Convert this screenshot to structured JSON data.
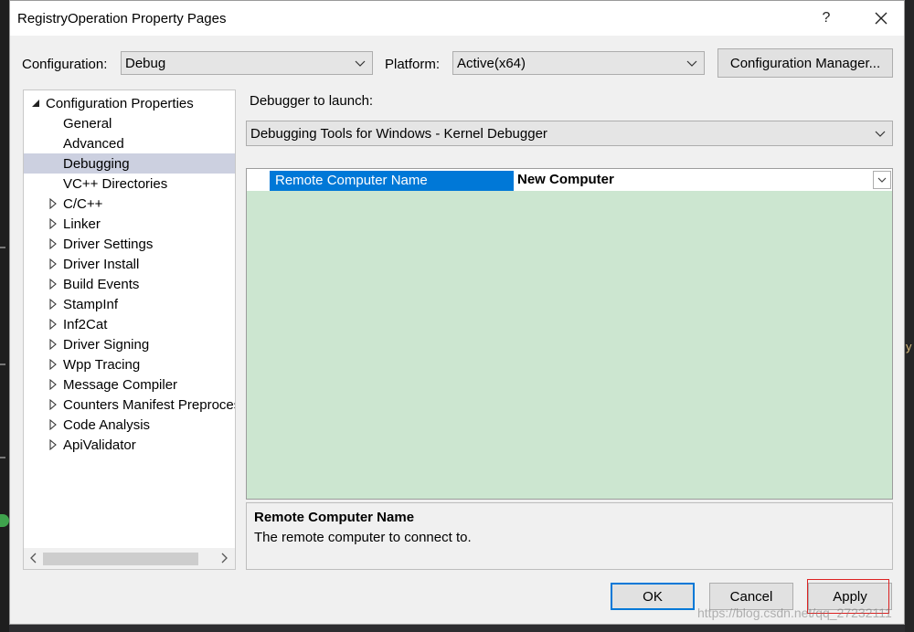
{
  "window": {
    "title": "RegistryOperation Property Pages",
    "help_glyph": "?",
    "close_glyph": "✕"
  },
  "header": {
    "configuration_label": "Configuration:",
    "configuration_value": "Debug",
    "platform_label": "Platform:",
    "platform_value": "Active(x64)",
    "config_manager_label": "Configuration Manager..."
  },
  "tree": {
    "root": "Configuration Properties",
    "items": [
      {
        "label": "General",
        "expandable": false,
        "selected": false
      },
      {
        "label": "Advanced",
        "expandable": false,
        "selected": false
      },
      {
        "label": "Debugging",
        "expandable": false,
        "selected": true
      },
      {
        "label": "VC++ Directories",
        "expandable": false,
        "selected": false
      },
      {
        "label": "C/C++",
        "expandable": true,
        "selected": false
      },
      {
        "label": "Linker",
        "expandable": true,
        "selected": false
      },
      {
        "label": "Driver Settings",
        "expandable": true,
        "selected": false
      },
      {
        "label": "Driver Install",
        "expandable": true,
        "selected": false
      },
      {
        "label": "Build Events",
        "expandable": true,
        "selected": false
      },
      {
        "label": "StampInf",
        "expandable": true,
        "selected": false
      },
      {
        "label": "Inf2Cat",
        "expandable": true,
        "selected": false
      },
      {
        "label": "Driver Signing",
        "expandable": true,
        "selected": false
      },
      {
        "label": "Wpp Tracing",
        "expandable": true,
        "selected": false
      },
      {
        "label": "Message Compiler",
        "expandable": true,
        "selected": false
      },
      {
        "label": "Counters Manifest Preprocessor",
        "expandable": true,
        "selected": false
      },
      {
        "label": "Code Analysis",
        "expandable": true,
        "selected": false
      },
      {
        "label": "ApiValidator",
        "expandable": true,
        "selected": false
      }
    ]
  },
  "debugger": {
    "launch_label": "Debugger to launch:",
    "launch_value": "Debugging Tools for Windows - Kernel Debugger"
  },
  "property_grid": {
    "rows": [
      {
        "name": "Remote Computer Name",
        "value": "New Computer"
      }
    ]
  },
  "description": {
    "title": "Remote Computer Name",
    "text": "The remote computer to connect to."
  },
  "buttons": {
    "ok": "OK",
    "cancel": "Cancel",
    "apply": "Apply"
  },
  "watermark": "https://blog.csdn.net/qq_27232111",
  "background_glyph": "y",
  "colors": {
    "selection_blue": "#0078d7",
    "grid_green": "#cce6d0",
    "tree_selected": "#ccd0e0",
    "apply_highlight": "#dd2222",
    "ok_border": "#0078d7"
  }
}
